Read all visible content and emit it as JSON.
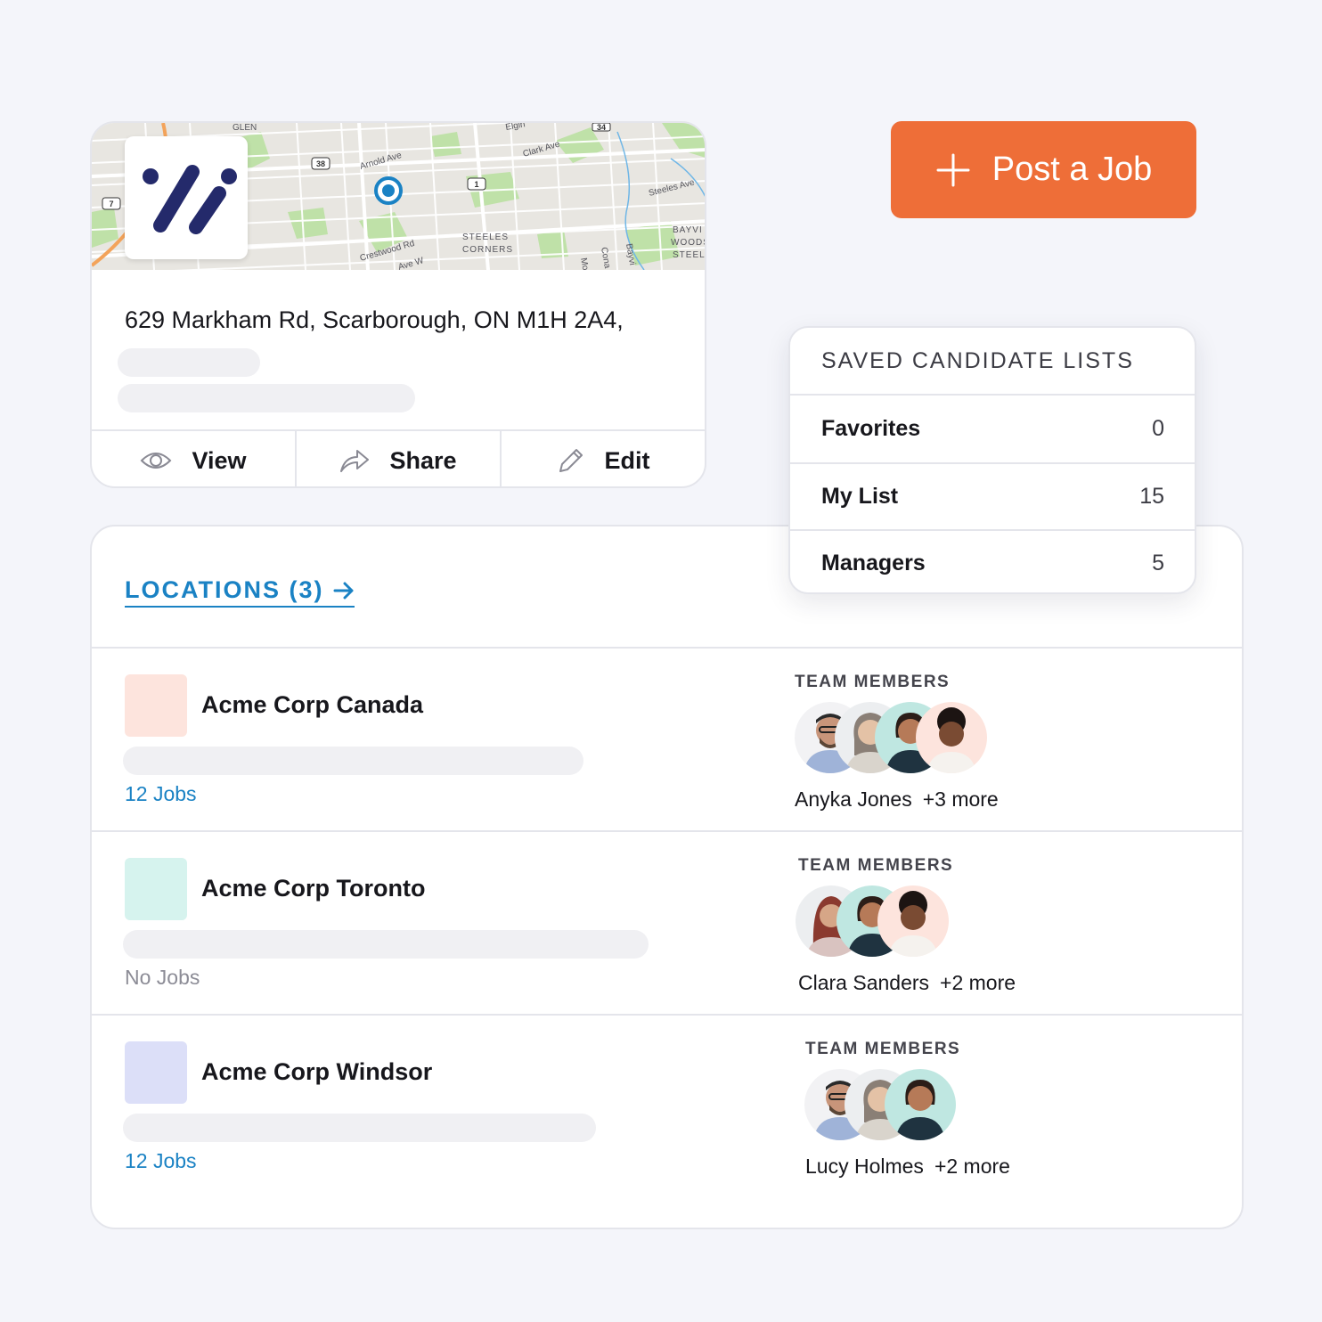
{
  "company_card": {
    "address": "629 Markham Rd, Scarborough, ON M1H 2A4,",
    "map": {
      "labels": [
        "GLEN",
        "Arnold Ave",
        "Clark Ave",
        "Elgin",
        "Steeles Ave",
        "Crestwood Rd",
        "Ave W",
        "STEELES",
        "CORNERS",
        "BAYVI",
        "WOODS",
        "STEEL",
        "Bayvi",
        "Cona",
        "Mo"
      ],
      "route_badges": [
        "38",
        "7",
        "1",
        "34"
      ]
    },
    "actions": [
      {
        "label": "View",
        "icon": "eye-icon"
      },
      {
        "label": "Share",
        "icon": "share-arrow-icon"
      },
      {
        "label": "Edit",
        "icon": "pencil-icon"
      }
    ]
  },
  "post_job": {
    "label": "Post a Job",
    "icon": "plus-icon"
  },
  "saved_lists": {
    "title": "SAVED CANDIDATE LISTS",
    "items": [
      {
        "label": "Favorites",
        "count": "0"
      },
      {
        "label": "My List",
        "count": "15"
      },
      {
        "label": "Managers",
        "count": "5"
      }
    ]
  },
  "locations": {
    "header": "LOCATIONS (3)",
    "header_icon": "arrow-right-icon",
    "rows": [
      {
        "name": "Acme Corp Canada",
        "jobs": "12 Jobs",
        "swatch_color": "#fde4dd",
        "team_label": "TEAM MEMBERS",
        "team_lead": "Anyka Jones",
        "team_more": "+3 more"
      },
      {
        "name": "Acme Corp Toronto",
        "jobs": "No Jobs",
        "swatch_color": "#d6f3ee",
        "team_label": "TEAM MEMBERS",
        "team_lead": "Clara Sanders",
        "team_more": "+2 more"
      },
      {
        "name": "Acme Corp Windsor",
        "jobs": "12 Jobs",
        "swatch_color": "#dcdff8",
        "team_label": "TEAM MEMBERS",
        "team_lead": "Lucy Holmes",
        "team_more": "+2 more"
      }
    ]
  },
  "colors": {
    "accent": "#ee6e38",
    "link": "#1a82c4",
    "brand_navy": "#242a6b"
  }
}
